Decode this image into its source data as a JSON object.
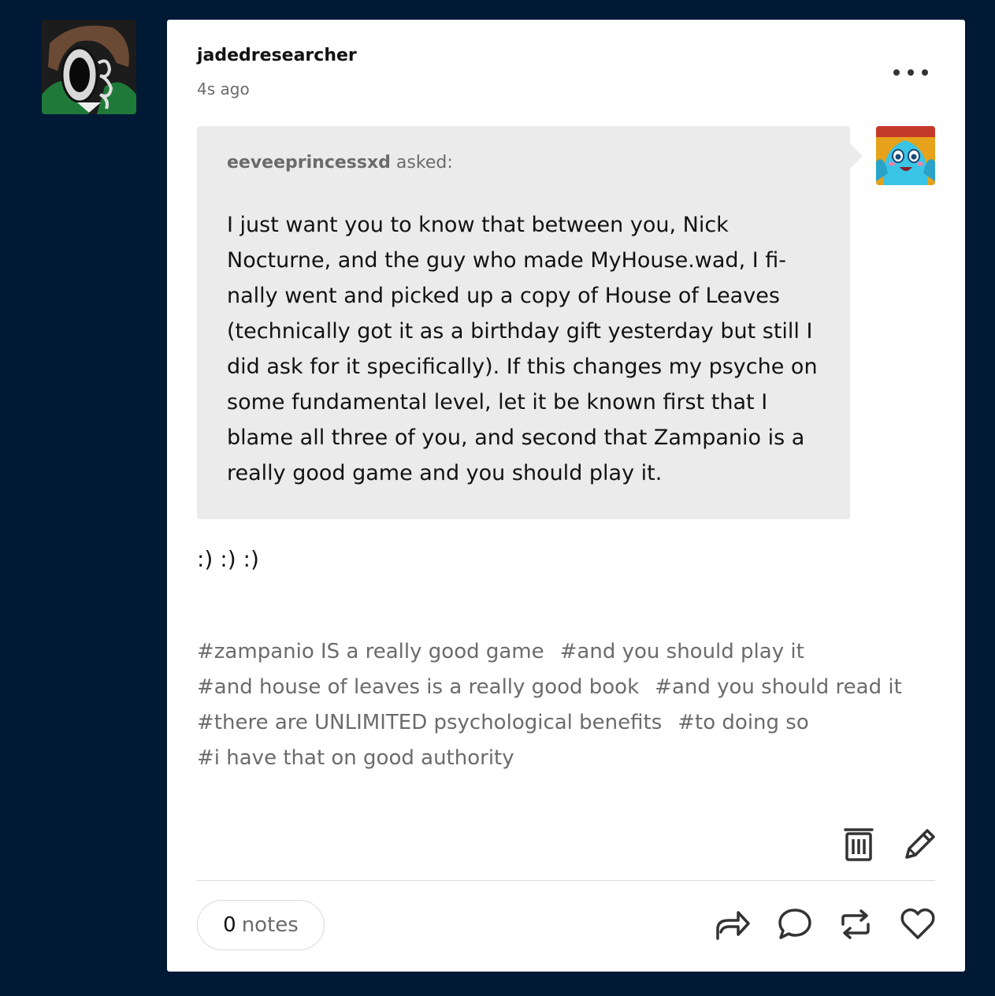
{
  "post": {
    "username": "jadedresearcher",
    "timestamp": "4s ago",
    "ask": {
      "asker": "eeveeprincessxd",
      "asked_label": "asked:",
      "question": "I just want you to know that between you, Nick Nocturne, and the guy who made MyHouse.wad, I fi-nally went and picked up a copy of House of Leaves (technically got it as a birthday gift yesterday but still I did ask for it specifically). If this changes my psyche on some fundamental level, let it be known first that I blame all three of you, and second that Zampanio is a really good game and you should play it."
    },
    "answer": ":) :) :)",
    "tags": [
      "#zampanio IS a really good game",
      "#and you should play it",
      "#and house of leaves is a really good book",
      "#and you should read it",
      "#there are UNLIMITED psychological benefits",
      "#to doing so",
      "#i have that on good authority"
    ],
    "notes": {
      "count": "0",
      "label": "notes"
    }
  },
  "icons": {
    "menu": "ellipsis-icon",
    "delete": "trash-icon",
    "edit": "pencil-icon",
    "share": "share-icon",
    "reply": "reply-icon",
    "reblog": "reblog-icon",
    "like": "heart-icon"
  },
  "colors": {
    "background": "#001935",
    "card": "#ffffff",
    "ask_box": "#ebebeb",
    "text": "#121212",
    "muted": "#6b6b6b"
  }
}
